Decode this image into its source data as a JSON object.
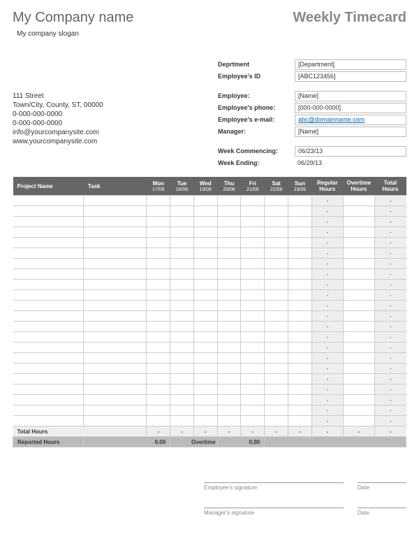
{
  "company": {
    "name": "My Company name",
    "slogan": "My company slogan",
    "address1": "111 Street",
    "address2": "Town/City, County, ST, 00000",
    "phone1": "0-000-000-0000",
    "phone2": "0-000-000-0000",
    "email": "info@yourcompanysite.com",
    "website": "www.yourcompanysite.com"
  },
  "doc_title": "Weekly Timecard",
  "fields": {
    "dept_label": "Deprtment",
    "dept_value": "[Department]",
    "empid_label": "Employee's ID",
    "empid_value": "[ABC123456]",
    "employee_label": "Employee:",
    "employee_value": "[Name]",
    "phone_label": "Employee's phone:",
    "phone_value": "[000-000-0000]",
    "email_label": "Employee's e-mail:",
    "email_value": "abc@domainname.com",
    "manager_label": "Manager:",
    "manager_value": "[Name]",
    "week_start_label": "Week Commencing:",
    "week_start_value": "06/23/13",
    "week_end_label": "Week Ending:",
    "week_end_value": "06/29/13"
  },
  "table": {
    "headers": {
      "project": "Project Name",
      "task": "Task",
      "days": [
        {
          "name": "Mon",
          "date": "17/06"
        },
        {
          "name": "Tue",
          "date": "18/06"
        },
        {
          "name": "Wed",
          "date": "19/06"
        },
        {
          "name": "Thu",
          "date": "20/06"
        },
        {
          "name": "Fri",
          "date": "21/06"
        },
        {
          "name": "Sat",
          "date": "22/06"
        },
        {
          "name": "Sun",
          "date": "23/06"
        }
      ],
      "regular": "Regular Hours",
      "overtime": "Overtime Hours",
      "total": "Total Hours"
    },
    "row_count": 22,
    "dash": "-",
    "totals_label": "Total Hours",
    "reported_label": "Reported Hours",
    "reported_value": "0.00",
    "overtime_label": "Overtime",
    "overtime_value": "0.00"
  },
  "signatures": {
    "employee": "Employee's signature",
    "manager": "Manager's signature",
    "date": "Date"
  }
}
